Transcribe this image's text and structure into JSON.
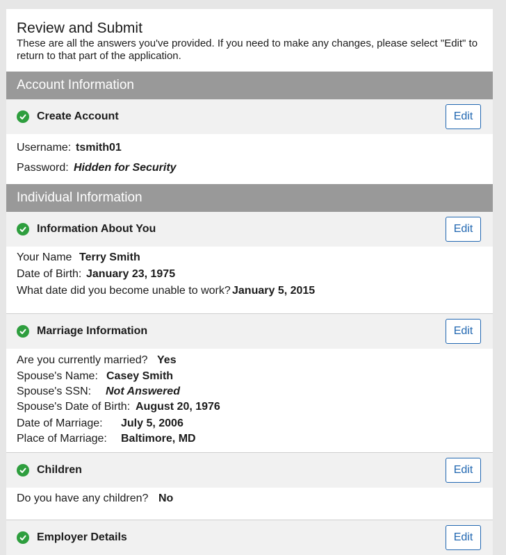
{
  "intro": {
    "title": "Review and Submit",
    "description": "These are all the answers you've provided. If you need to make any changes, please select \"Edit\" to return to that part of the application."
  },
  "sections": {
    "account": {
      "title": "Account Information"
    },
    "individual": {
      "title": "Individual Information"
    }
  },
  "edit_label": "Edit",
  "create_account": {
    "title": "Create Account",
    "fields": [
      {
        "label": "Username:",
        "value": "tsmith01"
      },
      {
        "label": "Password:",
        "value": "Hidden for Security"
      }
    ]
  },
  "about_you": {
    "title": "Information About You",
    "fields": [
      {
        "label": "Your Name",
        "value": "Terry Smith"
      },
      {
        "label": "Date of Birth:",
        "value": "January 23, 1975"
      },
      {
        "label": "What date did you become unable to work?",
        "value": "January 5, 2015"
      }
    ]
  },
  "marriage": {
    "title": "Marriage Information",
    "fields": [
      {
        "label": "Are you currently married?",
        "value": "Yes"
      },
      {
        "label": "Spouse's Name:",
        "value": "Casey Smith"
      },
      {
        "label": "Spouse's SSN:",
        "value": "Not Answered"
      },
      {
        "label": "Spouse's Date of Birth:",
        "value": "August 20, 1976"
      },
      {
        "label": "Date of Marriage:",
        "value": "July 5, 2006"
      },
      {
        "label": "Place of Marriage:",
        "value": "Baltimore, MD"
      }
    ]
  },
  "children": {
    "title": "Children",
    "fields": [
      {
        "label": "Do you have any children?",
        "value": "No"
      }
    ]
  },
  "employer": {
    "title": "Employer Details"
  }
}
